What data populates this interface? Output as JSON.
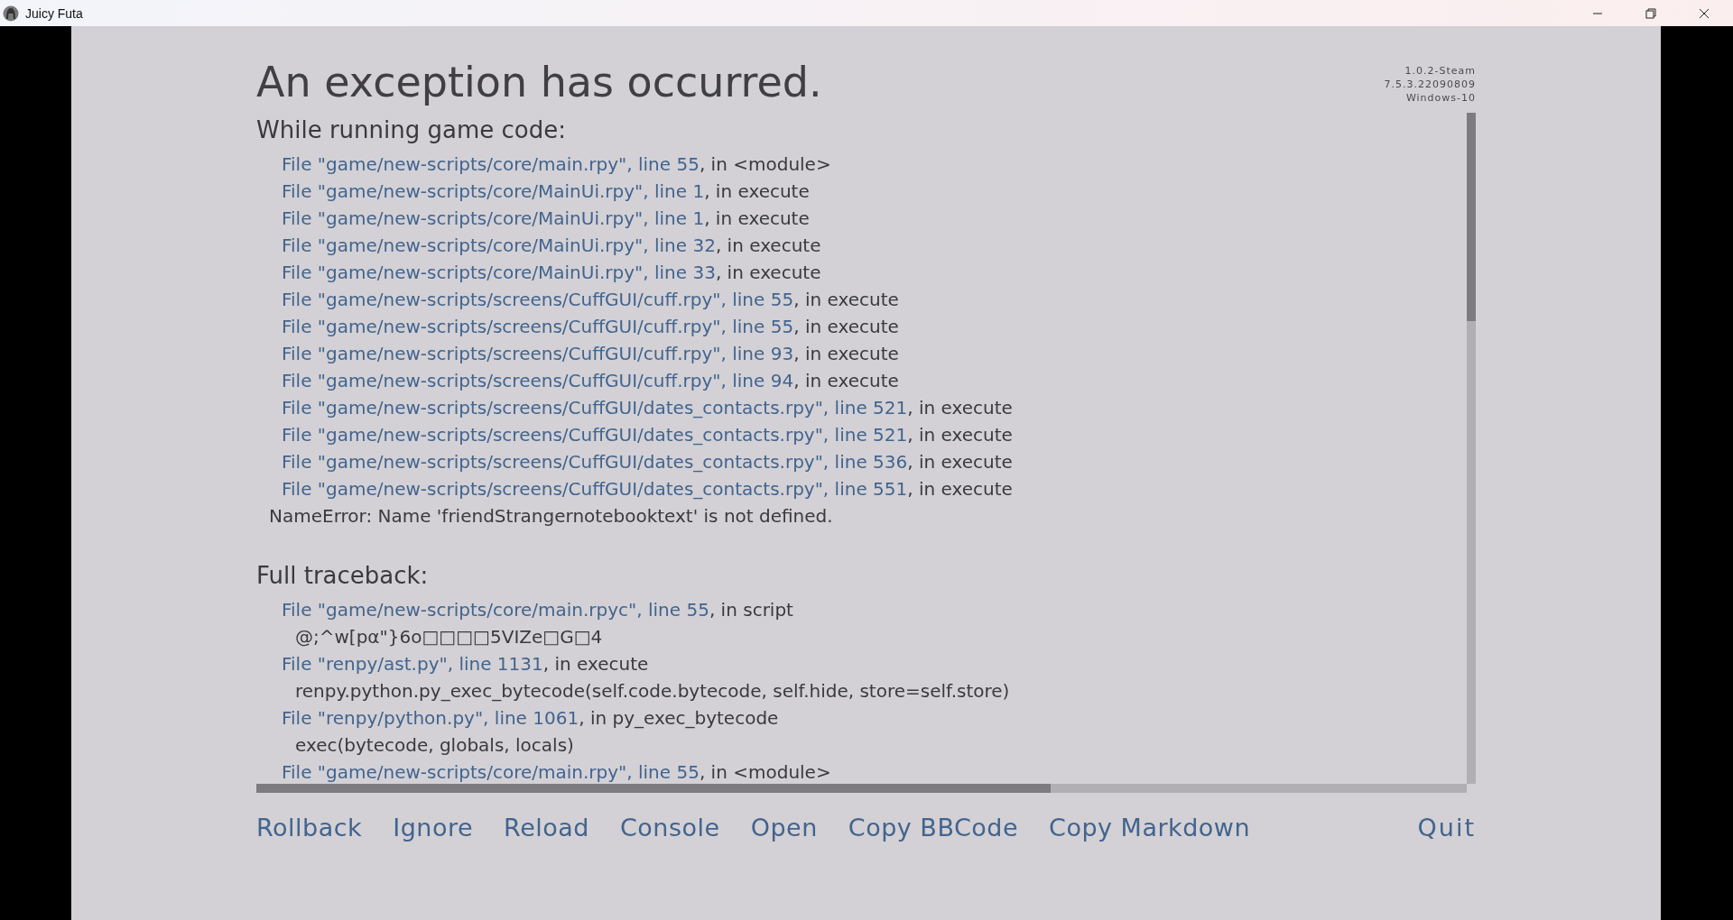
{
  "window": {
    "title": "Juicy Futa"
  },
  "title": "An exception has occurred.",
  "version_info": [
    "1.0.2-Steam",
    "7.5.3.22090809",
    "Windows-10"
  ],
  "sections": [
    {
      "heading": "While running game code:",
      "lines": [
        {
          "kind": "frame",
          "file": "File \"game/new-scripts/core/main.rpy\", line 55",
          "rest": ", in <module>"
        },
        {
          "kind": "frame",
          "file": "File \"game/new-scripts/core/MainUi.rpy\", line 1",
          "rest": ", in execute"
        },
        {
          "kind": "frame",
          "file": "File \"game/new-scripts/core/MainUi.rpy\", line 1",
          "rest": ", in execute"
        },
        {
          "kind": "frame",
          "file": "File \"game/new-scripts/core/MainUi.rpy\", line 32",
          "rest": ", in execute"
        },
        {
          "kind": "frame",
          "file": "File \"game/new-scripts/core/MainUi.rpy\", line 33",
          "rest": ", in execute"
        },
        {
          "kind": "frame",
          "file": "File \"game/new-scripts/screens/CuffGUI/cuff.rpy\", line 55",
          "rest": ", in execute"
        },
        {
          "kind": "frame",
          "file": "File \"game/new-scripts/screens/CuffGUI/cuff.rpy\", line 55",
          "rest": ", in execute"
        },
        {
          "kind": "frame",
          "file": "File \"game/new-scripts/screens/CuffGUI/cuff.rpy\", line 93",
          "rest": ", in execute"
        },
        {
          "kind": "frame",
          "file": "File \"game/new-scripts/screens/CuffGUI/cuff.rpy\", line 94",
          "rest": ", in execute"
        },
        {
          "kind": "frame",
          "file": "File \"game/new-scripts/screens/CuffGUI/dates_contacts.rpy\", line 521",
          "rest": ", in execute"
        },
        {
          "kind": "frame",
          "file": "File \"game/new-scripts/screens/CuffGUI/dates_contacts.rpy\", line 521",
          "rest": ", in execute"
        },
        {
          "kind": "frame",
          "file": "File \"game/new-scripts/screens/CuffGUI/dates_contacts.rpy\", line 536",
          "rest": ", in execute"
        },
        {
          "kind": "frame",
          "file": "File \"game/new-scripts/screens/CuffGUI/dates_contacts.rpy\", line 551",
          "rest": ", in execute"
        },
        {
          "kind": "error",
          "text": "NameError: Name 'friendStrangernotebooktext' is not defined."
        }
      ]
    },
    {
      "heading": "Full traceback:",
      "lines": [
        {
          "kind": "frame",
          "file": "File \"game/new-scripts/core/main.rpyc\", line 55",
          "rest": ", in script"
        },
        {
          "kind": "code",
          "text": "@;^w[pα\"}6o□□□□5VIZe□G□4"
        },
        {
          "kind": "frame",
          "file": "File \"renpy/ast.py\", line 1131",
          "rest": ", in execute"
        },
        {
          "kind": "code",
          "text": "renpy.python.py_exec_bytecode(self.code.bytecode, self.hide, store=self.store)"
        },
        {
          "kind": "frame",
          "file": "File \"renpy/python.py\", line 1061",
          "rest": ", in py_exec_bytecode"
        },
        {
          "kind": "code",
          "text": "exec(bytecode, globals, locals)"
        },
        {
          "kind": "frame",
          "file": "File \"game/new-scripts/core/main.rpy\", line 55",
          "rest": ", in <module>"
        }
      ]
    }
  ],
  "buttons": [
    "Rollback",
    "Ignore",
    "Reload",
    "Console",
    "Open",
    "Copy BBCode",
    "Copy Markdown"
  ],
  "quit": "Quit"
}
